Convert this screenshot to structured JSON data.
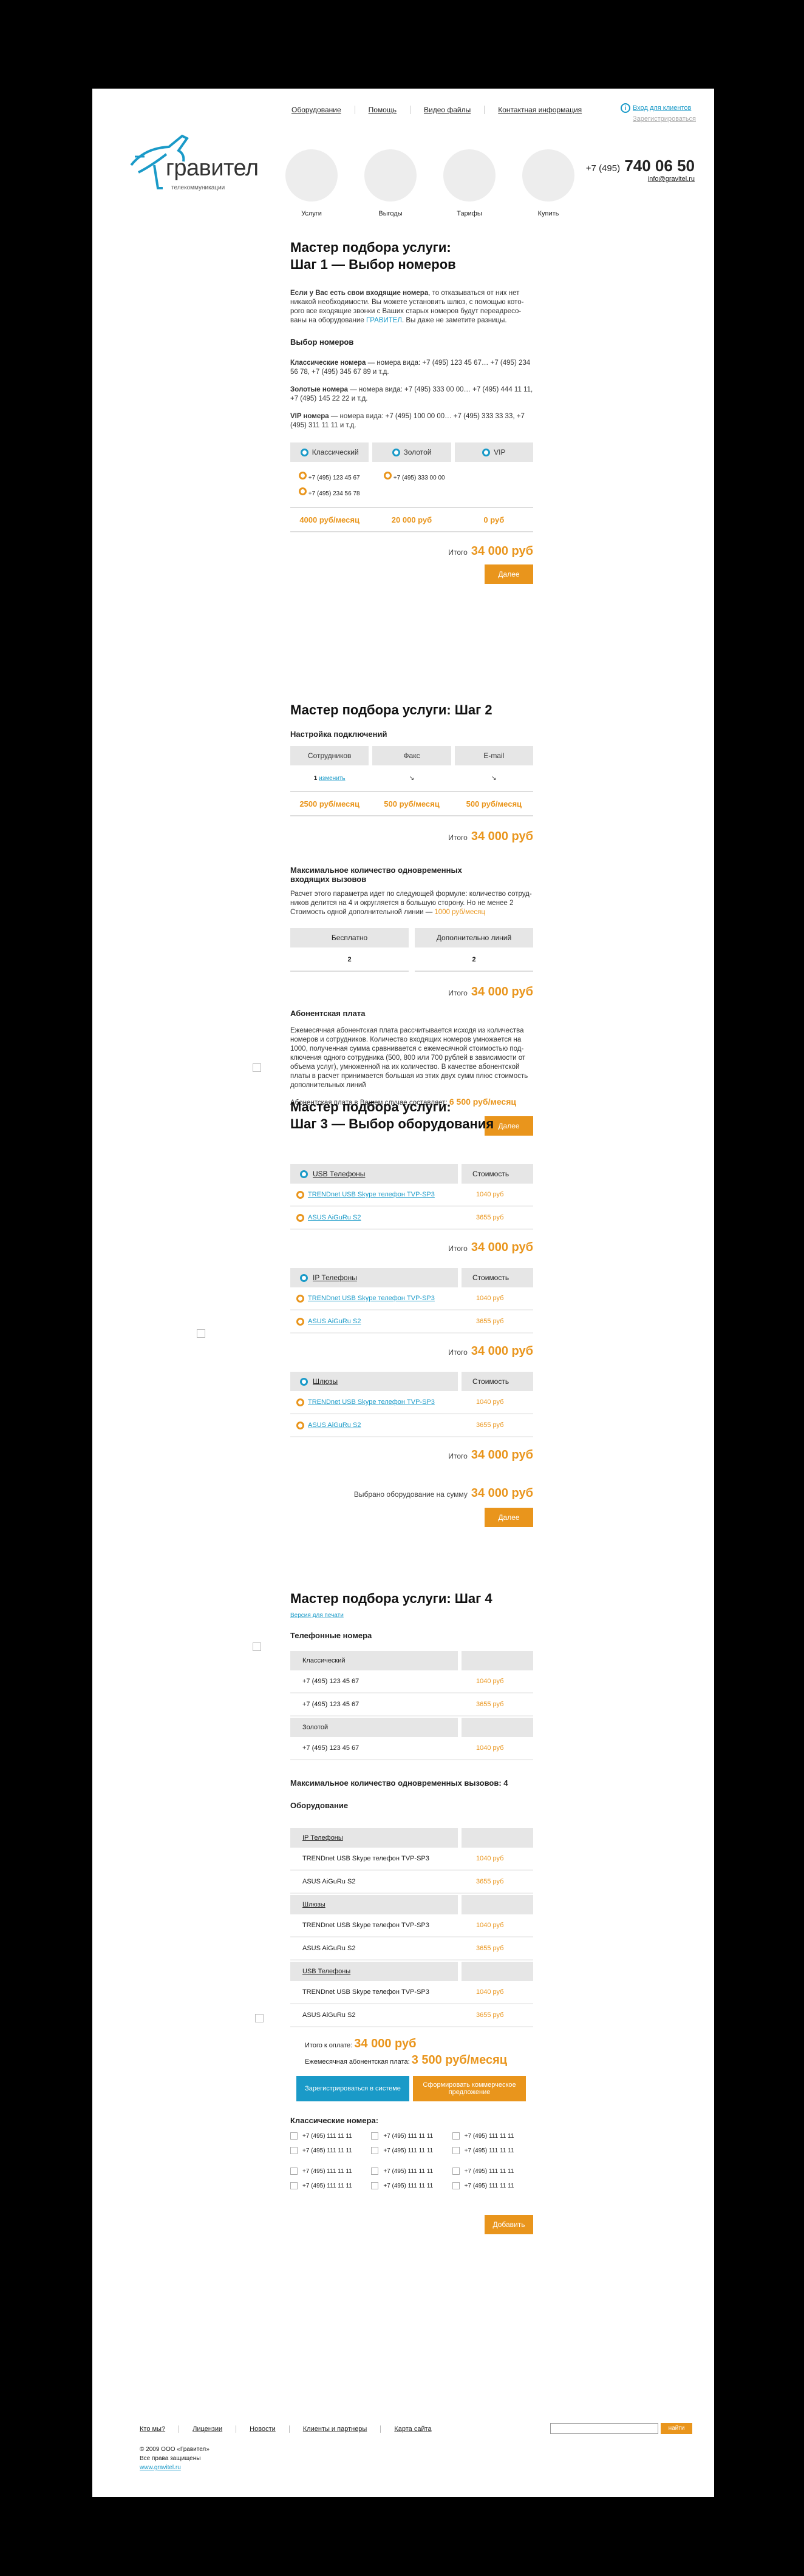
{
  "header": {
    "nav": [
      "Оборудование",
      "Помощь",
      "Видео файлы",
      "Контактная информация"
    ],
    "login": "Вход для клиентов",
    "register": "Зарегистрироваться",
    "logo_text": "гравител",
    "logo_sub": "телекоммуникации",
    "circles": [
      "Услуги",
      "Выгоды",
      "Тарифы",
      "Купить"
    ],
    "phone_code": "+7 (495)",
    "phone_num": "740 06 50",
    "email": "info@gravitel.ru"
  },
  "step1": {
    "title": "Мастер подбора услуги:\nШаг 1 — Выбор номеров",
    "intro_bold": "Если у Вас есть свои входящие номера",
    "intro_rest": ", то отказываться от них нет никакой необходимости. Вы можете установить шлюз, с помощью кото-рого все входящие звонки с Ваших старых номеров будут переадресо-ваны на оборудование ",
    "intro_brand": "ГРАВИТЕЛ",
    "intro_end": ". Вы даже не заметите разницы.",
    "choose": "Выбор номеров",
    "classic_b": "Классические номера",
    "classic_t": " — номера вида: +7 (495) 123 45 67… +7 (495) 234 56 78, +7 (495) 345 67 89 и т.д.",
    "gold_b": "Золотые номера",
    "gold_t": " — номера вида: +7 (495) 333 00 00… +7 (495) 444 11 11, +7 (495) 145 22 22 и т.д.",
    "vip_b": "VIP номера",
    "vip_t": " — номера вида: +7 (495) 100 00 00… +7 (495) 333 33 33, +7 (495) 311 11 11 и т.д.",
    "tabs": [
      "Классический",
      "Золотой",
      "VIP"
    ],
    "classic_nums": [
      "+7 (495) 123 45 67",
      "+7 (495) 234 56 78"
    ],
    "gold_nums": [
      "+7 (495) 333 00 00"
    ],
    "prices": [
      "4000 руб/месяц",
      "20 000 руб",
      "0 руб"
    ],
    "total_label": "Итого",
    "total": "34 000 руб",
    "next": "Далее"
  },
  "step2": {
    "title": "Мастер подбора услуги: Шаг 2",
    "sub": "Настройка подключений",
    "tabs": [
      "Сотрудников",
      "Факс",
      "E-mail"
    ],
    "emp_count": "1",
    "emp_change": "изменить",
    "prices": [
      "2500 руб/месяц",
      "500 руб/месяц",
      "500 руб/месяц"
    ],
    "total_label": "Итого",
    "total": "34 000 руб",
    "max_title": "Максимальное количество одновременных входящих вызовов",
    "max_text": "Расчет этого параметра идет по следующей формуле: количество сотруд-ников делится на 4 и округляется в большую сторону. Но не менее 2 Стоимость одной дополнительной линии — ",
    "max_price": "1000 руб/месяц",
    "lines_tabs": [
      "Бесплатно",
      "Дополнительно линий"
    ],
    "lines_vals": [
      "2",
      "2"
    ],
    "total2": "34 000 руб",
    "abon_title": "Абонентская плата",
    "abon_text": "Ежемесячная абонентская плата рассчитывается исходя из количества номеров и сотрудников. Количество входящих номеров умножается на 1000, полученная сумма сравнивается с ежемесячной стоимостью под-ключения одного сотрудника (500, 800 или 700 рублей в зависимости от объема услуг), умноженной на их количество. В качестве абонентской платы в расчет принимается большая из этих двух сумм плюс стоимость дополнительных линий",
    "abon_case": "Абонентская плата в Вашем случае составляет:",
    "abon_value": "6 500 руб/месяц",
    "next": "Далее"
  },
  "step3": {
    "title": "Мастер подбора услуги:\nШаг 3 — Выбор оборудования",
    "cost_col": "Стоимость",
    "groups": [
      {
        "name": "USB Телефоны",
        "items": [
          {
            "n": "TRENDnet USB Skype телефон TVP-SP3",
            "p": "1040 руб"
          },
          {
            "n": "ASUS AiGuRu S2",
            "p": "3655 руб"
          }
        ],
        "total": "34 000 руб"
      },
      {
        "name": "IP Телефоны",
        "items": [
          {
            "n": "TRENDnet USB Skype телефон TVP-SP3",
            "p": "1040 руб"
          },
          {
            "n": "ASUS AiGuRu S2",
            "p": "3655 руб"
          }
        ],
        "total": "34 000 руб"
      },
      {
        "name": "Шлюзы",
        "items": [
          {
            "n": "TRENDnet USB Skype телефон TVP-SP3",
            "p": "1040 руб"
          },
          {
            "n": "ASUS AiGuRu S2",
            "p": "3655 руб"
          }
        ],
        "total": "34 000 руб"
      }
    ],
    "total_label": "Итого",
    "chosen_label": "Выбрано оборудование на сумму",
    "chosen_total": "34 000 руб",
    "next": "Далее"
  },
  "step4": {
    "title": "Мастер подбора услуги: Шаг 4",
    "print": "Версия для печати",
    "phones_title": "Телефонные номера",
    "classic_head": "Классический",
    "classic_rows": [
      {
        "n": "+7 (495) 123 45 67",
        "p": "1040 руб"
      },
      {
        "n": "+7 (495) 123 45 67",
        "p": "3655 руб"
      }
    ],
    "gold_head": "Золотой",
    "gold_rows": [
      {
        "n": "+7 (495) 123 45 67",
        "p": "1040 руб"
      }
    ],
    "max_calls": "Максимальное количество одновременных вызовов: 4",
    "eq_title": "Оборудование",
    "eq_groups": [
      {
        "name": "IP Телефоны",
        "rows": [
          {
            "n": "TRENDnet USB Skype телефон TVP-SP3",
            "p": "1040 руб"
          },
          {
            "n": "ASUS AiGuRu S2",
            "p": "3655 руб"
          }
        ]
      },
      {
        "name": "Шлюзы",
        "rows": [
          {
            "n": "TRENDnet USB Skype телефон TVP-SP3",
            "p": "1040 руб"
          },
          {
            "n": "ASUS AiGuRu S2",
            "p": "3655 руб"
          }
        ]
      },
      {
        "name": "USB Телефоны",
        "rows": [
          {
            "n": "TRENDnet USB Skype телефон TVP-SP3",
            "p": "1040 руб"
          },
          {
            "n": "ASUS AiGuRu S2",
            "p": "3655 руб"
          }
        ]
      }
    ],
    "pay_label": "Итого к оплате:",
    "pay_value": "34 000 руб",
    "month_label": "Ежемесячная абонентская плата:",
    "month_value": "3 500 руб/месяц",
    "register_btn": "Зарегистрироваться в системе",
    "offer_btn": "Сформировать коммерческое предложение",
    "classic_title": "Классические номера:",
    "number": "+7 (495) 111 11 11",
    "add": "Добавить"
  },
  "footer": {
    "nav": [
      "Кто мы?",
      "Лицензии",
      "Новости",
      "Клиенты и партнеры",
      "Карта сайта"
    ],
    "search_btn": "найти",
    "copy1": "© 2009 ООО «Гравител»",
    "copy2": "Все права защищены",
    "site": "www.gravitel.ru"
  },
  "colors": {
    "accent": "#e9951c",
    "teal": "#1a9ac8",
    "gray": "#e6e6e6"
  }
}
